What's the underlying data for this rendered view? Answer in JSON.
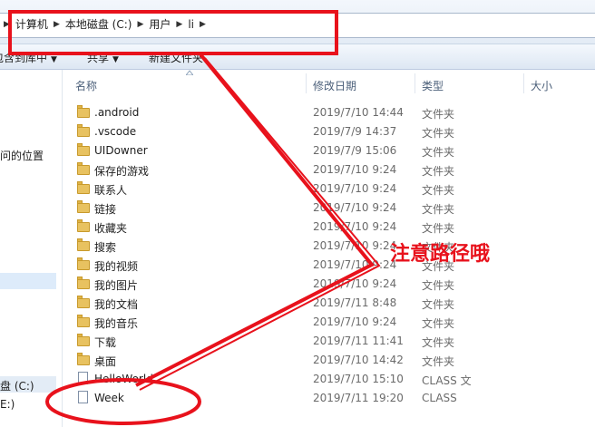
{
  "address_bar": {
    "crumbs": [
      "计算机",
      "本地磁盘 (C:)",
      "用户",
      "li"
    ]
  },
  "toolbar": {
    "include_library": "包含到库中",
    "share": "共享",
    "new_folder": "新建文件夹"
  },
  "nav": {
    "recent_places": "问的位置",
    "drive": "盘 (C:)",
    "drive2": "E:)"
  },
  "columns": {
    "name": "名称",
    "modified": "修改日期",
    "type": "类型",
    "size": "大小"
  },
  "files": [
    {
      "name": ".android",
      "date": "2019/7/10 14:44",
      "type": "文件夹",
      "icon": "folder-icon"
    },
    {
      "name": ".vscode",
      "date": "2019/7/9 14:37",
      "type": "文件夹",
      "icon": "folder-icon"
    },
    {
      "name": "UIDowner",
      "date": "2019/7/9 15:06",
      "type": "文件夹",
      "icon": "folder-icon"
    },
    {
      "name": "保存的游戏",
      "date": "2019/7/10 9:24",
      "type": "文件夹",
      "icon": "saved-games-folder-icon"
    },
    {
      "name": "联系人",
      "date": "2019/7/10 9:24",
      "type": "文件夹",
      "icon": "contacts-folder-icon"
    },
    {
      "name": "链接",
      "date": "2019/7/10 9:24",
      "type": "文件夹",
      "icon": "links-folder-icon"
    },
    {
      "name": "收藏夹",
      "date": "2019/7/10 9:24",
      "type": "文件夹",
      "icon": "favorites-folder-icon"
    },
    {
      "name": "搜索",
      "date": "2019/7/10 9:24",
      "type": "文件夹",
      "icon": "searches-folder-icon"
    },
    {
      "name": "我的视频",
      "date": "2019/7/10 9:24",
      "type": "文件夹",
      "icon": "videos-folder-icon"
    },
    {
      "name": "我的图片",
      "date": "2019/7/10 9:24",
      "type": "文件夹",
      "icon": "pictures-folder-icon"
    },
    {
      "name": "我的文档",
      "date": "2019/7/11 8:48",
      "type": "文件夹",
      "icon": "documents-folder-icon"
    },
    {
      "name": "我的音乐",
      "date": "2019/7/10 9:24",
      "type": "文件夹",
      "icon": "music-folder-icon"
    },
    {
      "name": "下载",
      "date": "2019/7/11 11:41",
      "type": "文件夹",
      "icon": "downloads-folder-icon"
    },
    {
      "name": "桌面",
      "date": "2019/7/10 14:42",
      "type": "文件夹",
      "icon": "desktop-folder-icon"
    },
    {
      "name": "HelloWorld",
      "date": "2019/7/10 15:10",
      "type": "CLASS 文",
      "icon": "file-icon"
    },
    {
      "name": "Week",
      "date": "2019/7/11 19:20",
      "type": "CLASS",
      "icon": "file-icon"
    }
  ],
  "annotation": {
    "text": "注意路径哦",
    "color": "#e8121c"
  },
  "colors": {
    "folder": "#e8c260",
    "header_text": "#4c607a",
    "selection": "#ddebfa"
  }
}
